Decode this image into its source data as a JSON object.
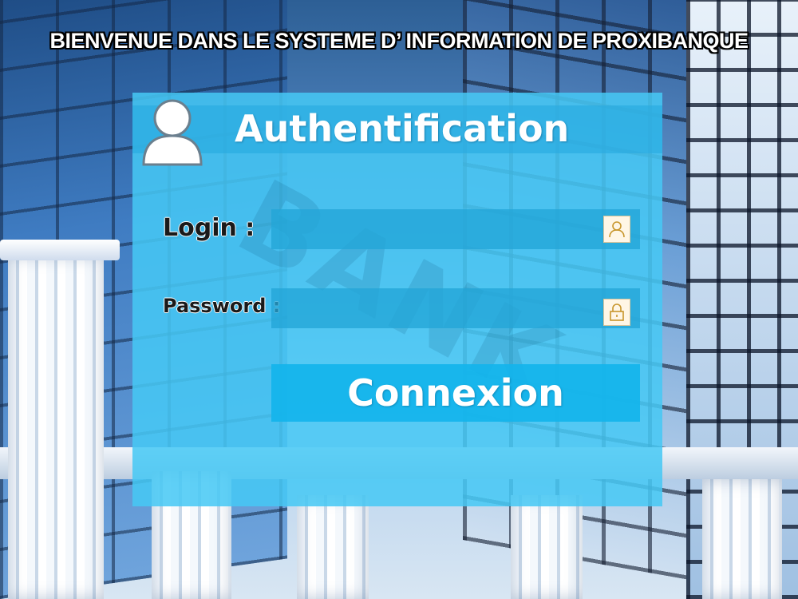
{
  "header": {
    "title": "BIENVENUE DANS LE SYSTEME D’ INFORMATION DE PROXIBANQUE"
  },
  "panel": {
    "title": "Authentification",
    "watermark": "BANK",
    "user_icon": "user-avatar-icon"
  },
  "form": {
    "login_label": "Login :",
    "login_value": "",
    "login_icon": "user-icon",
    "password_label": "Password :",
    "password_value": "",
    "password_icon": "lock-icon",
    "submit_label": "Connexion"
  },
  "colors": {
    "panel": "#46c8f5",
    "field": "#23a5d7",
    "button": "#14b4eb",
    "icon_accent": "#c8962c"
  }
}
